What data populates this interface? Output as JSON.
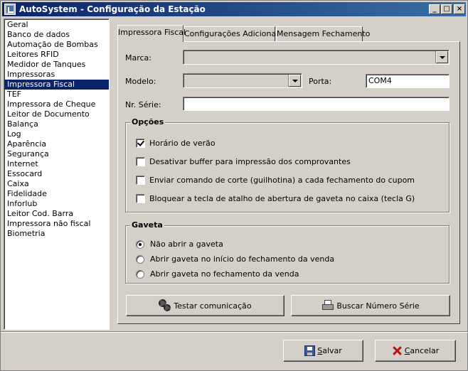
{
  "window": {
    "title": "AutoSystem - Configuração da Estação"
  },
  "sidebar": {
    "items": [
      {
        "label": "Geral"
      },
      {
        "label": "Banco de dados"
      },
      {
        "label": "Automação de Bombas"
      },
      {
        "label": "Leitores RFID"
      },
      {
        "label": "Medidor de Tanques"
      },
      {
        "label": "Impressoras"
      },
      {
        "label": "Impressora Fiscal",
        "selected": true
      },
      {
        "label": "TEF"
      },
      {
        "label": "Impressora de Cheque"
      },
      {
        "label": "Leitor de Documento"
      },
      {
        "label": "Balança"
      },
      {
        "label": "Log"
      },
      {
        "label": "Aparência"
      },
      {
        "label": "Segurança"
      },
      {
        "label": "Internet"
      },
      {
        "label": "Essocard"
      },
      {
        "label": "Caixa"
      },
      {
        "label": "Fidelidade"
      },
      {
        "label": "Inforlub"
      },
      {
        "label": "Leitor Cod. Barra"
      },
      {
        "label": "Impressora não fiscal"
      },
      {
        "label": "Biometria"
      }
    ]
  },
  "tabs": [
    {
      "label": "Impressora Fiscal",
      "active": true
    },
    {
      "label": "Configurações Adicionais"
    },
    {
      "label": "Mensagem Fechamento"
    }
  ],
  "form": {
    "marca_label": "Marca:",
    "marca_value": "",
    "modelo_label": "Modelo:",
    "modelo_value": "",
    "porta_label": "Porta:",
    "porta_value": "COM4",
    "serie_label": "Nr. Série:",
    "serie_value": ""
  },
  "opcoes": {
    "title": "Opções",
    "items": [
      {
        "label": "Horário de verão",
        "checked": true
      },
      {
        "label": "Desativar buffer para impressão dos comprovantes",
        "checked": false
      },
      {
        "label": "Enviar comando de corte (guilhotina) a cada fechamento do cupom",
        "checked": false
      },
      {
        "label": "Bloquear a tecla de atalho de abertura de gaveta no caixa (tecla G)",
        "checked": false
      }
    ]
  },
  "gaveta": {
    "title": "Gaveta",
    "options": [
      {
        "label": "Não abrir a gaveta",
        "selected": true
      },
      {
        "label": "Abrir gaveta no início do fechamento da venda",
        "selected": false
      },
      {
        "label": "Abrir gaveta no fechamento da venda",
        "selected": false
      }
    ]
  },
  "actions": {
    "testar": {
      "label": "Testar comunicação",
      "icon": "gears-icon"
    },
    "buscar": {
      "label": "Buscar Número Série",
      "icon": "printer-icon"
    }
  },
  "footer": {
    "save": {
      "label_first": "S",
      "label_rest": "alvar",
      "icon": "floppy-disk-icon"
    },
    "cancel": {
      "label_first": "C",
      "label_rest": "ancelar",
      "icon": "red-x-icon"
    }
  }
}
